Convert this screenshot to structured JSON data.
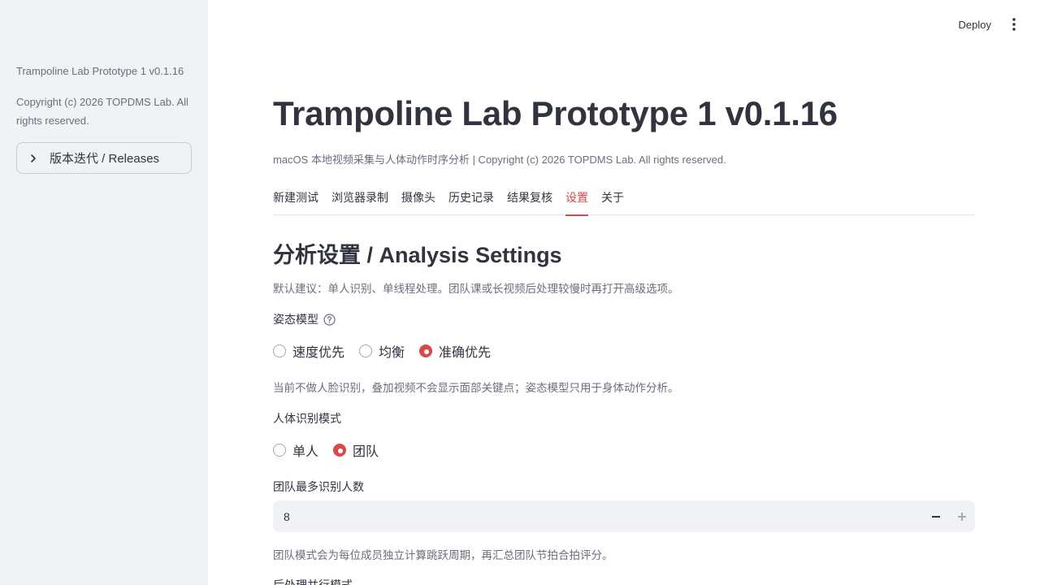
{
  "sidebar": {
    "caption": "Trampoline Lab Prototype 1 v0.1.16",
    "copyright": "Copyright (c) 2026 TOPDMS Lab. All rights reserved.",
    "expander_label": "版本迭代 / Releases"
  },
  "header": {
    "deploy_label": "Deploy"
  },
  "main": {
    "title": "Trampoline Lab Prototype 1 v0.1.16",
    "subtitle": "macOS 本地视频采集与人体动作时序分析 | Copyright (c) 2026 TOPDMS Lab. All rights reserved.",
    "tabs": [
      "新建测试",
      "浏览器录制",
      "摄像头",
      "历史记录",
      "结果复核",
      "设置",
      "关于"
    ],
    "active_tab": "设置",
    "section_title": "分析设置 / Analysis Settings",
    "default_caption": "默认建议：单人识别、单线程处理。团队课或长视频后处理较慢时再打开高级选项。",
    "pose_model": {
      "label": "姿态模型",
      "options": [
        "速度优先",
        "均衡",
        "准确优先"
      ],
      "selected": "准确优先",
      "caption": "当前不做人脸识别，叠加视频不会显示面部关键点；姿态模型只用于身体动作分析。"
    },
    "detection_mode": {
      "label": "人体识别模式",
      "options": [
        "单人",
        "团队"
      ],
      "selected": "团队"
    },
    "max_people": {
      "label": "团队最多识别人数",
      "value": "8",
      "caption": "团队模式会为每位成员独立计算跳跃周期，再汇总团队节拍合拍评分。"
    },
    "next_label": "后处理并行模式"
  },
  "colors": {
    "accent": "#d9484a",
    "sidebar_bg": "#f0f2f6",
    "text": "#31333f",
    "muted": "#6b6e7b"
  }
}
